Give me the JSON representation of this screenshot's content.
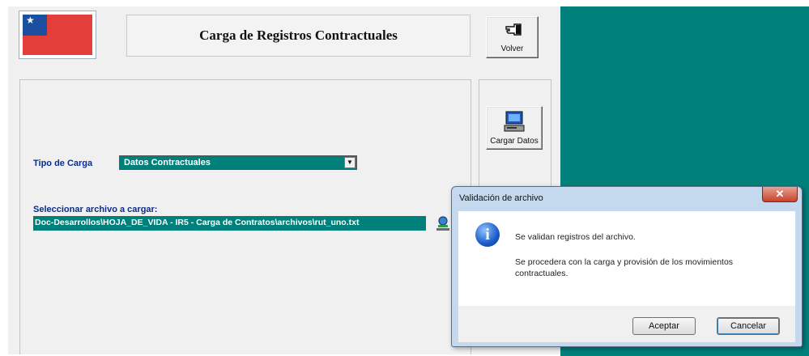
{
  "window": {
    "title": "Carga de Registros Contractuales",
    "back_button_label": "Volver",
    "load_button_label": "Cargar Datos"
  },
  "form": {
    "load_type_label": "Tipo de Carga",
    "load_type_value": "Datos Contractuales",
    "file_label": "Seleccionar archivo a cargar:",
    "file_path": "Doc-Desarrollos\\HOJA_DE_VIDA - IR5 - Carga de Contratos\\archivos\\rut_uno.txt"
  },
  "dialog": {
    "title": "Validación de archivo",
    "close_label": "✕",
    "message_1": "Se validan registros del archivo.",
    "message_2": "Se procedera con la carga y provisión de los movimientos contractuales.",
    "ok_label": "Aceptar",
    "cancel_label": "Cancelar",
    "icon": "info-icon"
  },
  "colors": {
    "teal": "#00807a",
    "label_blue": "#0b2d8b",
    "dialog_frame": "#c5d9ee"
  }
}
